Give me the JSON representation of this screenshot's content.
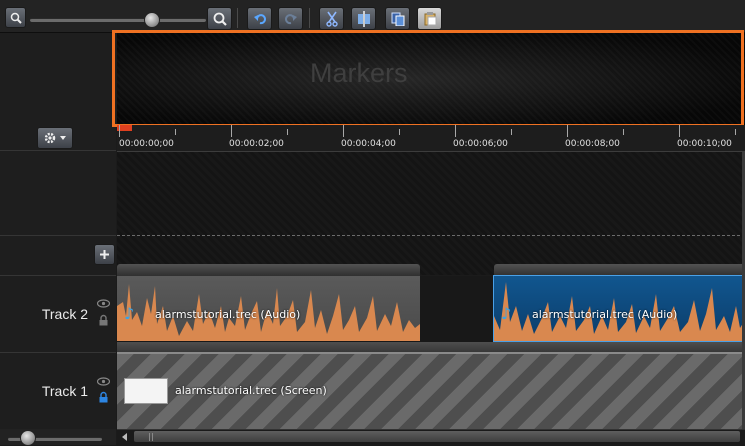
{
  "toolbar": {
    "icons": [
      "zoom-out-icon",
      "zoom-in-icon",
      "undo-icon",
      "redo-icon",
      "cut-icon",
      "split-icon",
      "copy-icon",
      "paste-icon"
    ]
  },
  "markers": {
    "label": "Markers"
  },
  "ruler": {
    "ticks": [
      "00:00:00;00",
      "00:00:02;00",
      "00:00:04;00",
      "00:00:06;00",
      "00:00:08;00",
      "00:00:10;00"
    ]
  },
  "tracks": [
    {
      "name": "Track 2",
      "clips": [
        "alarmstutorial.trec (Audio)",
        "alarmstutorial.trec (Audio)"
      ]
    },
    {
      "name": "Track 1",
      "clips": [
        "alarmstutorial.trec (Screen)"
      ]
    }
  ],
  "colors": {
    "accent_orange": "#ef7122",
    "audio_waveform": "#dc8a54",
    "selected_clip": "#0d4a80"
  }
}
